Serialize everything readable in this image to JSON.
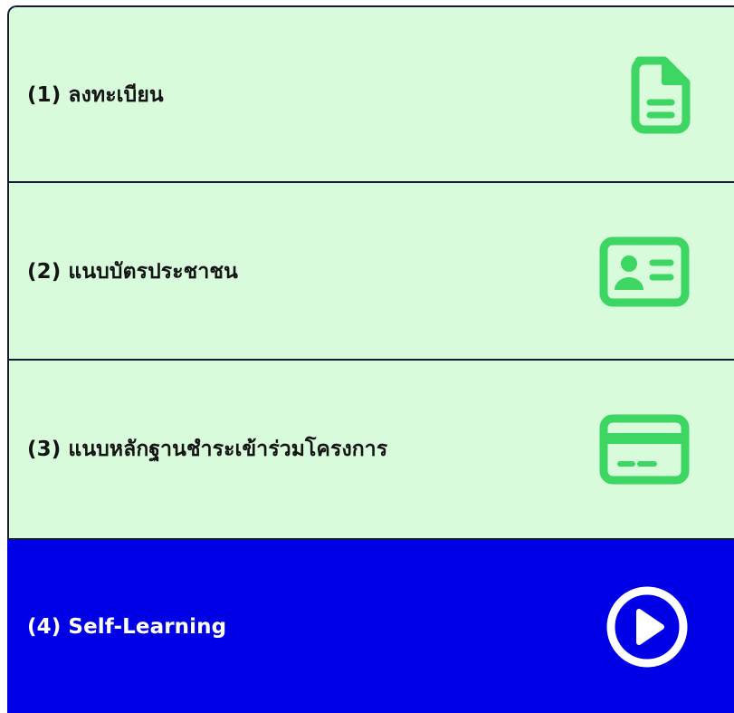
{
  "steps": [
    {
      "label": "(1) ลงทะเบียน",
      "icon": "document-icon",
      "state": "default"
    },
    {
      "label": "(2) แนบบัตรประชาชน",
      "icon": "id-card-icon",
      "state": "default"
    },
    {
      "label": "(3) แนบหลักฐานชำระเข้าร่วมโครงการ",
      "icon": "credit-card-icon",
      "state": "default"
    },
    {
      "label": "(4) Self-Learning",
      "icon": "play-circle-icon",
      "state": "active"
    }
  ],
  "colors": {
    "item_background": "#d7fbdb",
    "active_background": "#0000e6",
    "icon_green": "#3dd662",
    "border": "#161a33",
    "text_dark": "#141414",
    "text_active": "#ffffff"
  }
}
